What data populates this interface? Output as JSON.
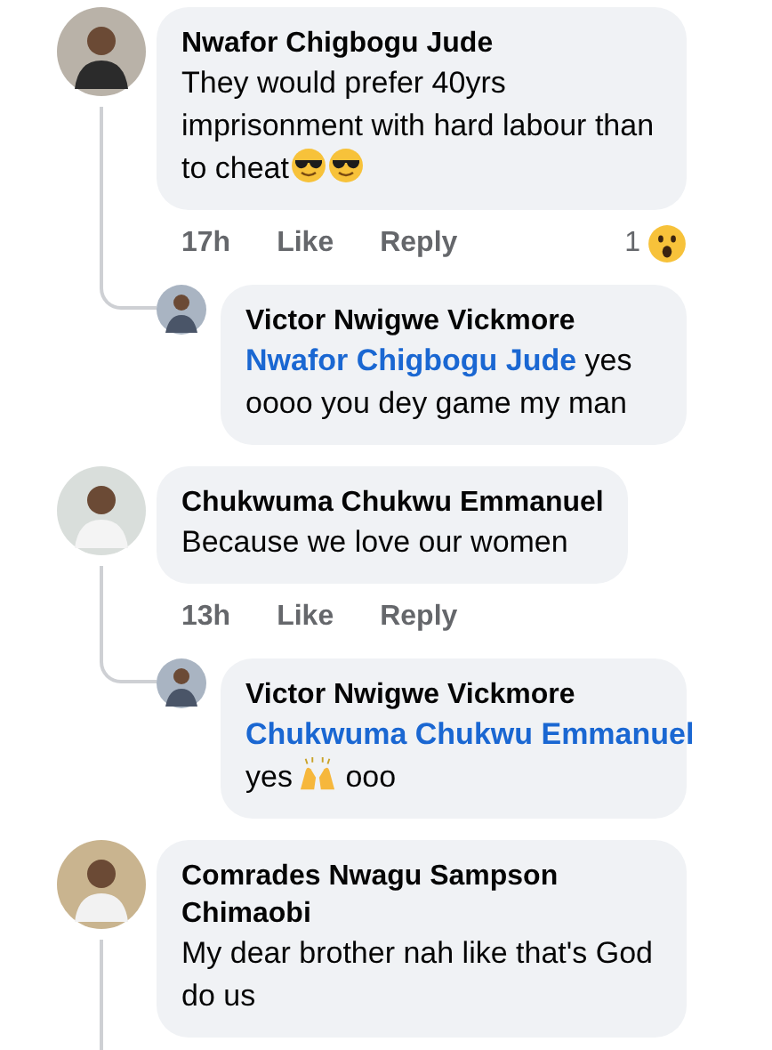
{
  "comments": [
    {
      "author": "Nwafor Chigbogu Jude",
      "body": [
        {
          "kind": "text",
          "text": "They would prefer 40yrs imprisonment with hard labour than to cheat"
        },
        {
          "kind": "sunglasses"
        },
        {
          "kind": "sunglasses"
        }
      ],
      "actions": {
        "time": "17h",
        "like": "Like",
        "reply": "Reply",
        "reaction_count": "1"
      },
      "replies": [
        {
          "author": "Victor Nwigwe Vickmore",
          "body": [
            {
              "kind": "mention",
              "text": "Nwafor Chigbogu Jude"
            },
            {
              "kind": "text",
              "text": "yes oooo you dey game my man"
            }
          ]
        }
      ]
    },
    {
      "author": "Chukwuma Chukwu Emmanuel",
      "body": [
        {
          "kind": "text",
          "text": "Because we love our women"
        }
      ],
      "actions": {
        "time": "13h",
        "like": "Like",
        "reply": "Reply"
      },
      "replies": [
        {
          "author": "Victor Nwigwe Vickmore",
          "body": [
            {
              "kind": "mention",
              "text": "Chukwuma Chukwu Emmanuel"
            },
            {
              "kind": "text",
              "text": "yes"
            },
            {
              "kind": "raised-hands"
            },
            {
              "kind": "text",
              "text": "ooo"
            }
          ]
        }
      ]
    },
    {
      "author": "Comrades Nwagu Sampson Chimaobi",
      "body": [
        {
          "kind": "text",
          "text": "My dear brother nah like that's God do us"
        }
      ]
    }
  ]
}
